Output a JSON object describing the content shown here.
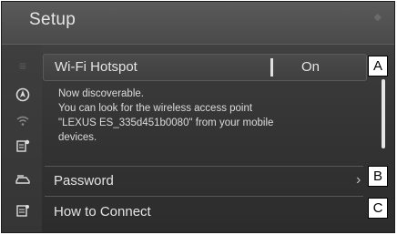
{
  "header": {
    "title": "Setup"
  },
  "wifi_hotspot": {
    "label": "Wi-Fi Hotspot",
    "state": "On"
  },
  "message_lines": [
    "Now discoverable.",
    "You can look for the wireless access point",
    "\"LEXUS ES_335d451b0080\" from your mobile",
    "devices."
  ],
  "password": {
    "label": "Password"
  },
  "how_to_connect": {
    "label": "How to Connect"
  },
  "callouts": {
    "a": "A",
    "b": "B",
    "c": "C"
  },
  "sidebar_icons": [
    "menu-icon",
    "navigation-icon",
    "wifi-icon",
    "phone-settings-icon",
    "vehicle-icon",
    "settings-list-icon"
  ]
}
